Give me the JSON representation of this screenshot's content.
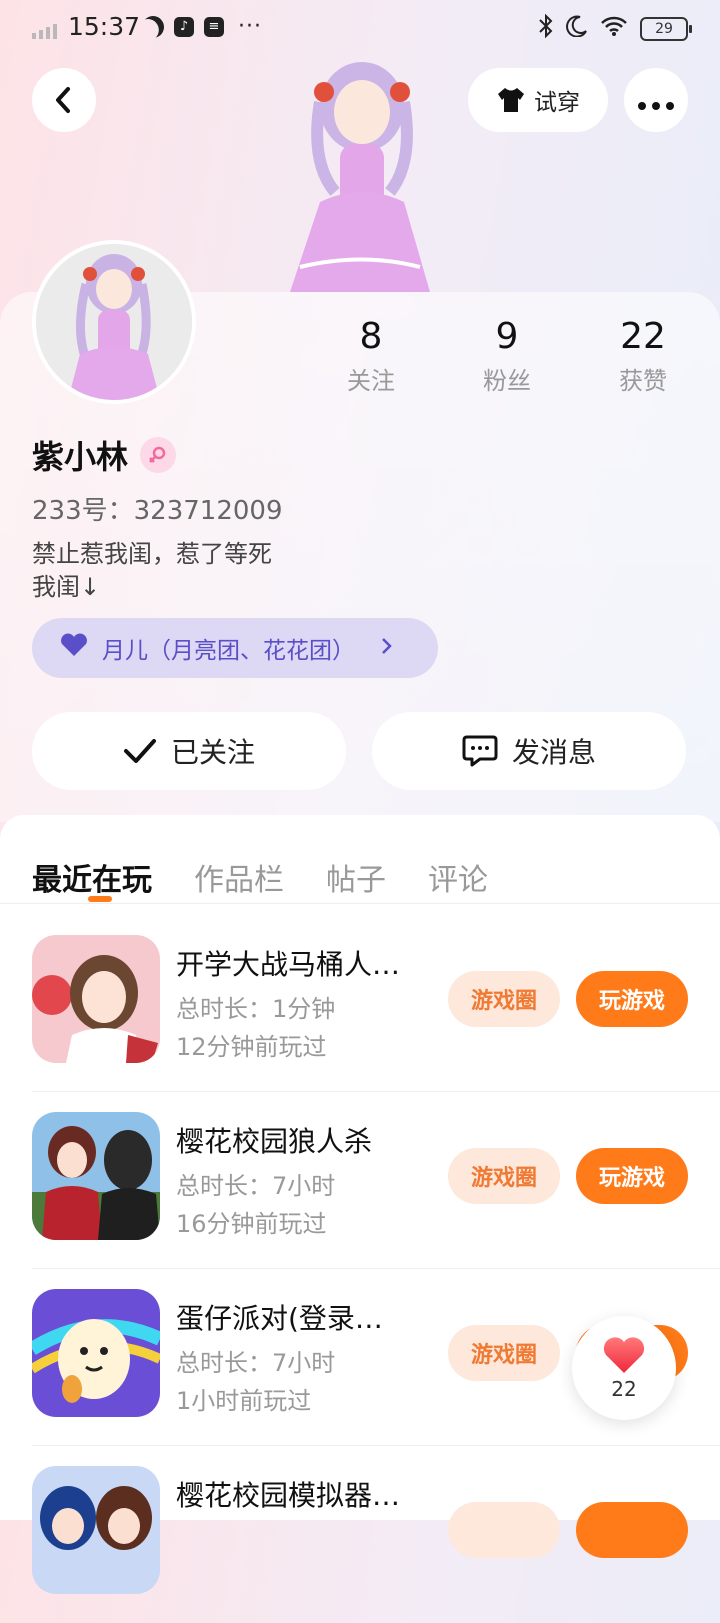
{
  "status_bar": {
    "time": "15:37",
    "battery": "29",
    "dots": "···"
  },
  "top_bar": {
    "try_on_label": "试穿"
  },
  "profile": {
    "stats": [
      {
        "num": "8",
        "label": "关注"
      },
      {
        "num": "9",
        "label": "粉丝"
      },
      {
        "num": "22",
        "label": "获赞"
      }
    ],
    "name": "紫小林",
    "uid": "233号：323712009",
    "bio_line1": "禁止惹我闺，惹了等死",
    "bio_line2": "我闺↓",
    "group": "月儿（月亮团、花花团）",
    "follow_label": "已关注",
    "message_label": "发消息"
  },
  "tabs": [
    "最近在玩",
    "作品栏",
    "帖子",
    "评论"
  ],
  "games": [
    {
      "title": "开学大战马桶人…",
      "duration": "总时长：1分钟",
      "last_played": "12分钟前玩过",
      "circle_label": "游戏圈",
      "play_label": "玩游戏"
    },
    {
      "title": "樱花校园狼人杀",
      "duration": "总时长：7小时",
      "last_played": "16分钟前玩过",
      "circle_label": "游戏圈",
      "play_label": "玩游戏"
    },
    {
      "title": "蛋仔派对(登录…",
      "duration": "总时长：7小时",
      "last_played": "1小时前玩过",
      "circle_label": "游戏圈",
      "play_label": "玩游戏"
    },
    {
      "title": "樱花校园模拟器…",
      "duration": "",
      "last_played": "",
      "circle_label": "",
      "play_label": ""
    }
  ],
  "like_fab": {
    "count": "22"
  },
  "colors": {
    "accent": "#ff7a18",
    "group_bg": "#ddd8f4",
    "group_text": "#5b4fc9"
  }
}
